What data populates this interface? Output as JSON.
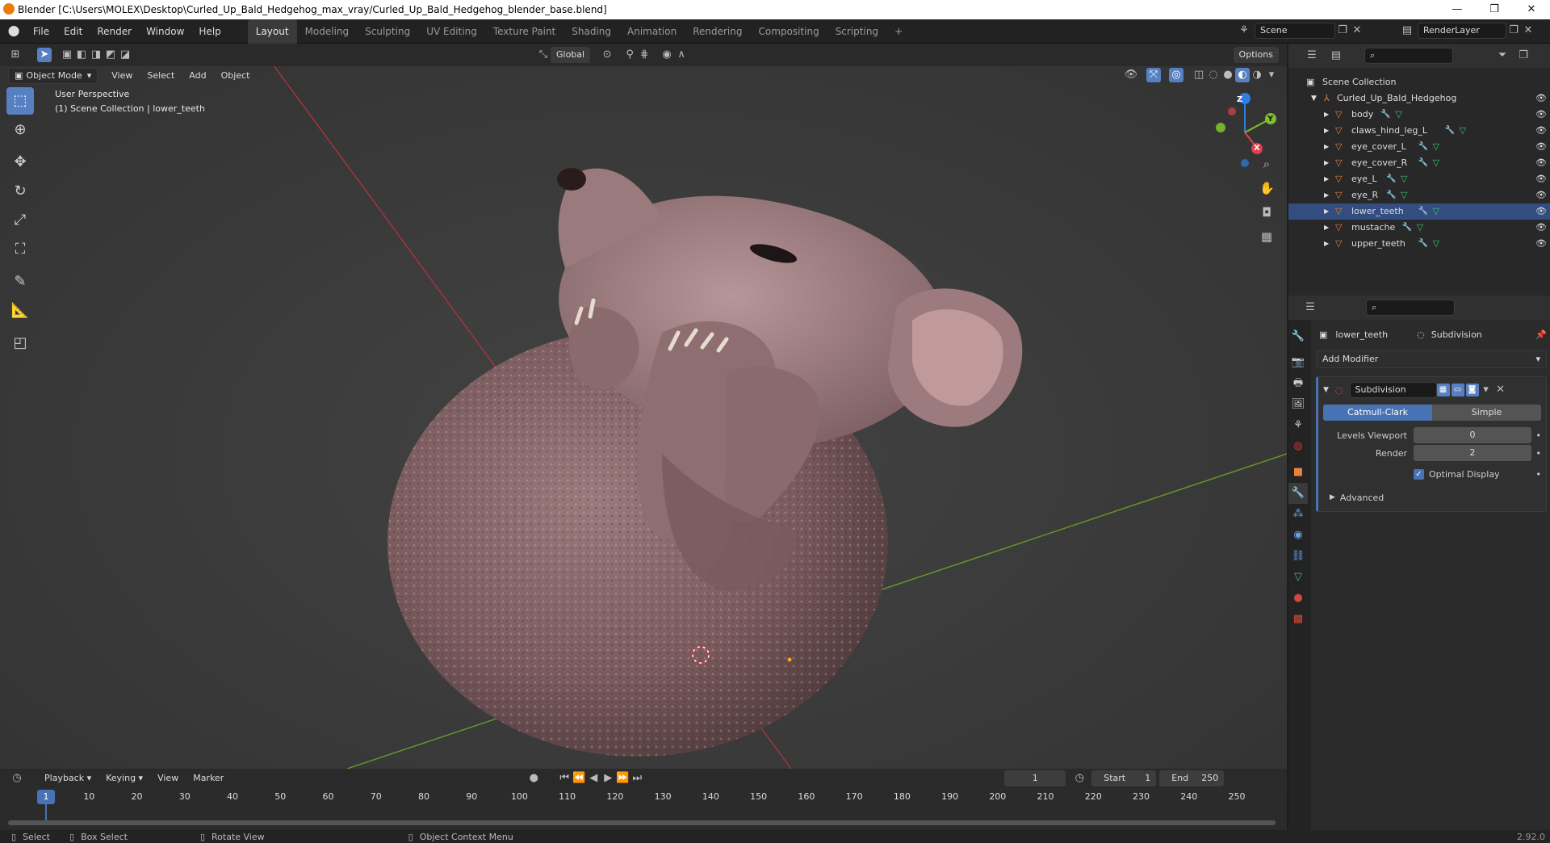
{
  "window": {
    "title": "Blender [C:\\Users\\MOLEX\\Desktop\\Curled_Up_Bald_Hedgehog_max_vray/Curled_Up_Bald_Hedgehog_blender_base.blend]",
    "minimize": "—",
    "maximize": "❐",
    "close": "✕"
  },
  "menus": [
    "File",
    "Edit",
    "Render",
    "Window",
    "Help"
  ],
  "workspaces": [
    "Layout",
    "Modeling",
    "Sculpting",
    "UV Editing",
    "Texture Paint",
    "Shading",
    "Animation",
    "Rendering",
    "Compositing",
    "Scripting"
  ],
  "active_workspace": "Layout",
  "add_workspace": "+",
  "scene": {
    "label": "Scene"
  },
  "renderlayer": {
    "label": "RenderLayer"
  },
  "viewport": {
    "mode": "Object Mode",
    "menus": [
      "View",
      "Select",
      "Add",
      "Object"
    ],
    "transform_orientation": "Global",
    "options": "Options",
    "overlay_line1": "User Perspective",
    "overlay_line2": "(1) Scene Collection | lower_teeth",
    "gizmo": {
      "x": "X",
      "y": "Y",
      "z": "Z"
    }
  },
  "outliner": {
    "root": "Scene Collection",
    "collection": "Curled_Up_Bald_Hedgehog",
    "items": [
      "body",
      "claws_hind_leg_L",
      "eye_cover_L",
      "eye_cover_R",
      "eye_L",
      "eye_R",
      "lower_teeth",
      "mustache",
      "upper_teeth"
    ],
    "selected": "lower_teeth"
  },
  "properties": {
    "object_name": "lower_teeth",
    "modifier_name_crumb": "Subdivision",
    "add_modifier": "Add Modifier",
    "modifier": {
      "name": "Subdivision",
      "type_a": "Catmull-Clark",
      "type_b": "Simple",
      "levels_viewport_label": "Levels Viewport",
      "levels_viewport": "0",
      "render_label": "Render",
      "render": "2",
      "optimal_display_label": "Optimal Display",
      "optimal_display": true,
      "advanced": "Advanced"
    }
  },
  "timeline": {
    "menus": [
      "Playback",
      "Keying",
      "View",
      "Marker"
    ],
    "current_frame": "1",
    "start_label": "Start",
    "start": "1",
    "end_label": "End",
    "end": "250",
    "ticks": [
      "10",
      "20",
      "30",
      "40",
      "50",
      "60",
      "70",
      "80",
      "90",
      "100",
      "110",
      "120",
      "130",
      "140",
      "150",
      "160",
      "170",
      "180",
      "190",
      "200",
      "210",
      "220",
      "230",
      "240",
      "250"
    ],
    "playhead": "1"
  },
  "statusbar": {
    "select": "Select",
    "box_select": "Box Select",
    "rotate_view": "Rotate View",
    "context_menu": "Object Context Menu",
    "version": "2.92.0"
  },
  "colors": {
    "accent": "#5680c2",
    "selection": "#334d80",
    "x_axis": "#e0404a",
    "y_axis": "#7fbf2a",
    "z_axis": "#2f7fe0",
    "object_icon": "#e8823a",
    "mesh_icon": "#3ec07a"
  }
}
